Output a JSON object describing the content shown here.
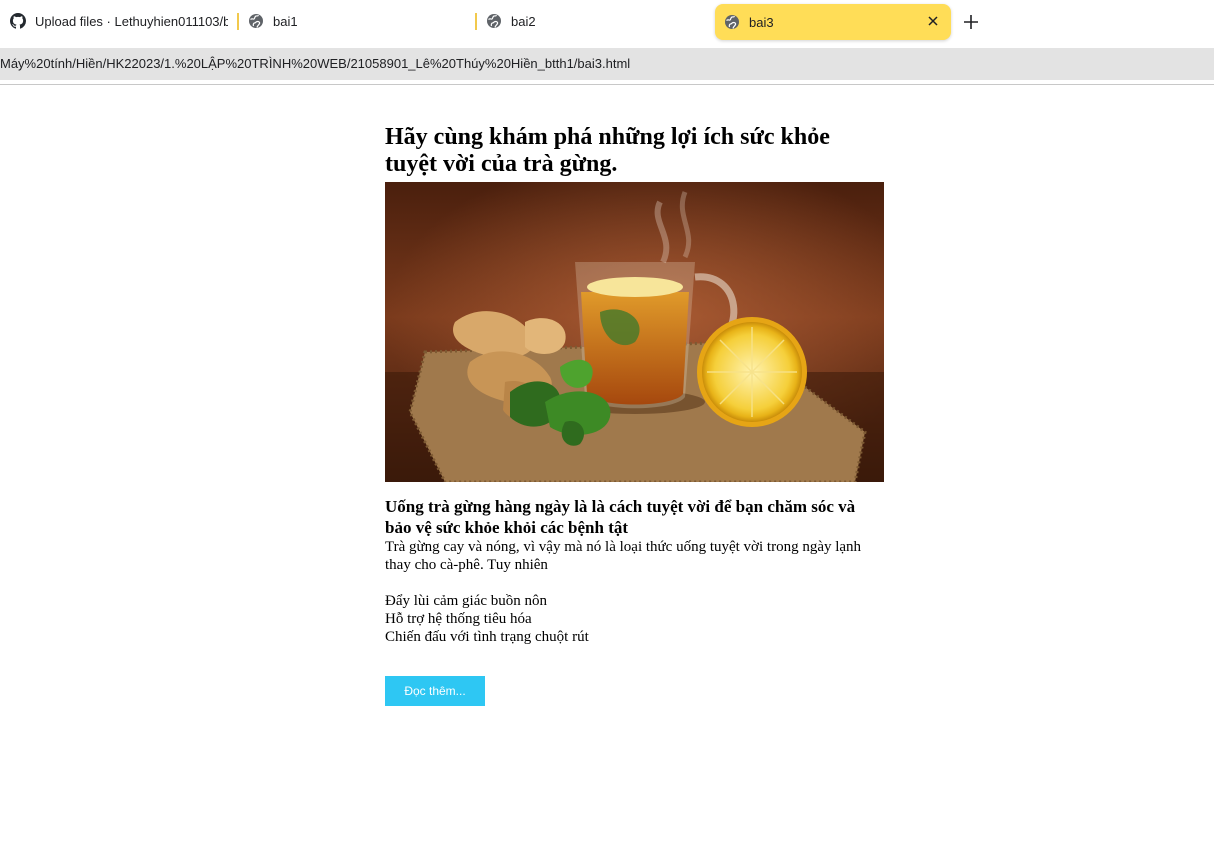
{
  "tabs": [
    {
      "title": "Upload files · Lethuyhien011103/b",
      "icon": "github-icon",
      "active": false
    },
    {
      "title": "bai1",
      "icon": "globe-icon",
      "active": false
    },
    {
      "title": "bai2",
      "icon": "globe-icon",
      "active": false
    },
    {
      "title": "bai3",
      "icon": "globe-icon",
      "active": true
    }
  ],
  "address": {
    "url": "Máy%20tính/Hiền/HK22023/1.%20LẬP%20TRÌNH%20WEB/21058901_Lê%20Thúy%20Hiền_btth1/bai3.html"
  },
  "page": {
    "heading": "Hãy cùng khám phá những lợi ích sức khỏe tuyệt vời của trà gừng.",
    "image": "ginger-tea-photo",
    "subheading": "Uống trà gừng hàng ngày là là cách tuyệt vời để bạn chăm sóc và bảo vệ sức khỏe khỏi các bệnh tật",
    "paragraph": "Trà gừng cay và nóng, vì vậy mà nó là loại thức uống tuyệt vời trong ngày lạnh thay cho cà-phê. Tuy nhiên",
    "benefits": [
      "Đẩy lùi cảm giác buồn nôn",
      "Hỗ trợ hệ thống tiêu hóa",
      "Chiến đấu với tình trạng chuột rút"
    ],
    "button_label": "Đọc thêm..."
  },
  "colors": {
    "active_tab": "#ffdd57",
    "address_bar": "#e3e3e3",
    "button": "#2ec7f3"
  }
}
